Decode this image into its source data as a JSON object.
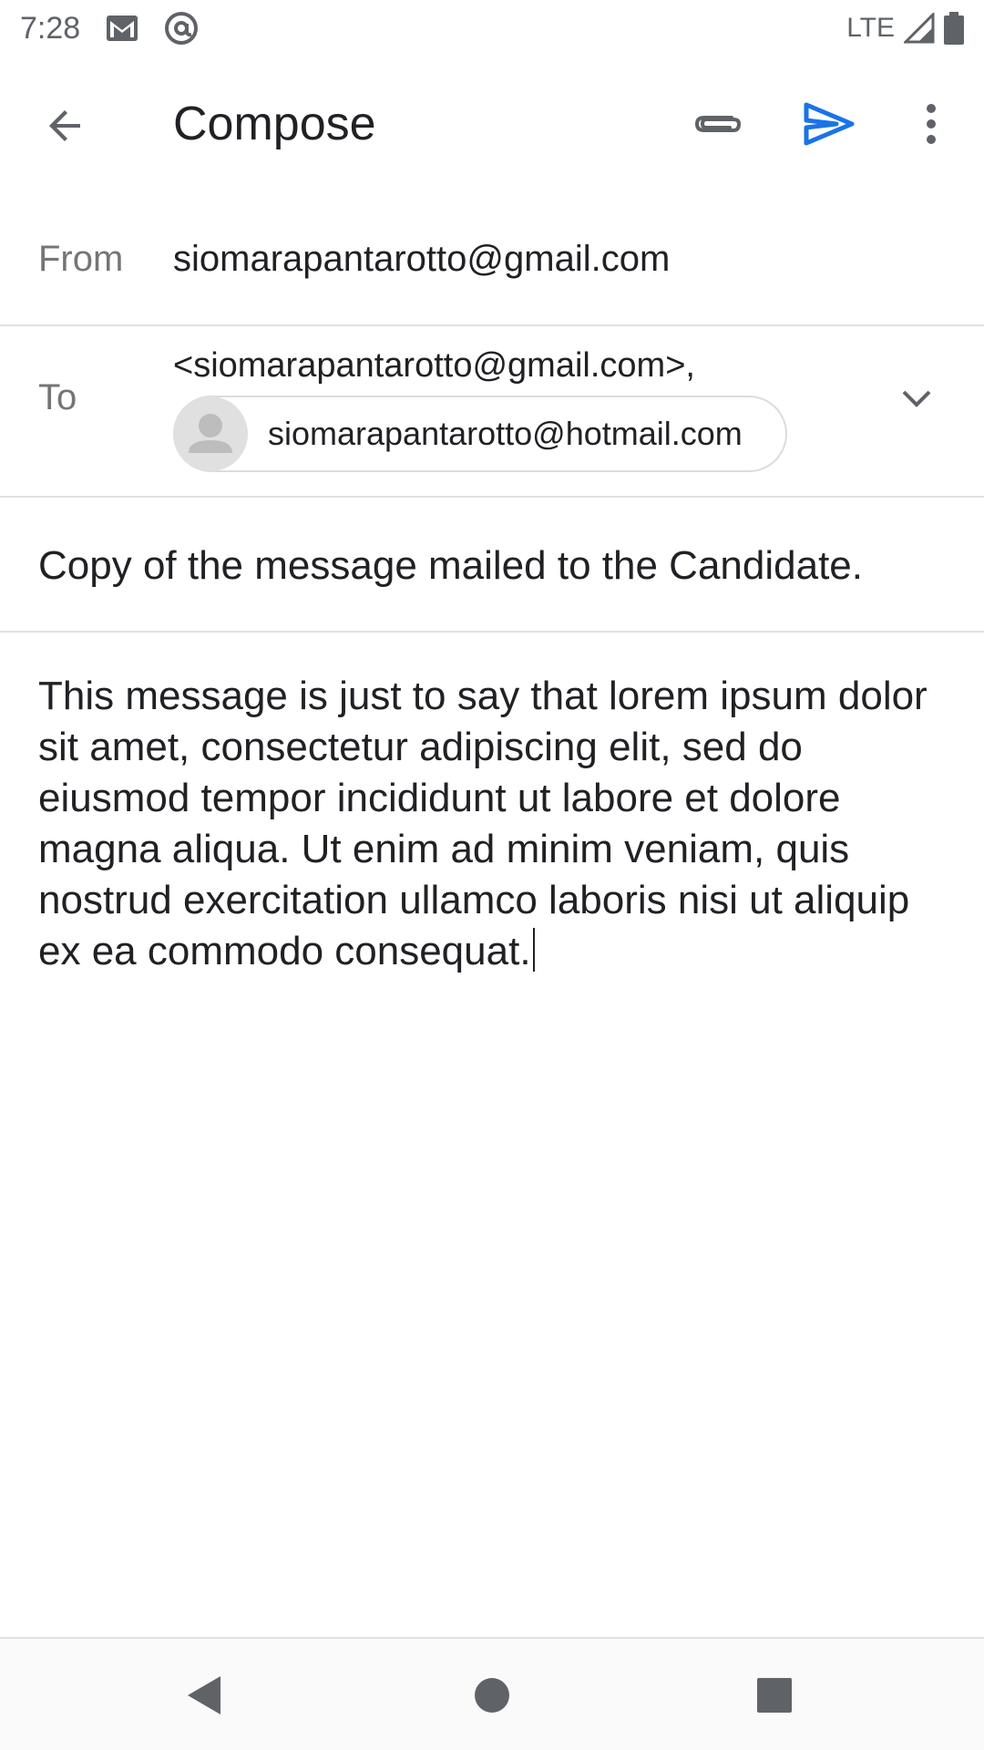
{
  "status_bar": {
    "time": "7:28",
    "network": "LTE",
    "icons": [
      "gmail-icon",
      "at-sign-icon",
      "signal-icon",
      "battery-icon"
    ]
  },
  "app_bar": {
    "title": "Compose",
    "icons": [
      "back-arrow-icon",
      "paperclip-icon",
      "send-icon",
      "more-vert-icon"
    ],
    "send_color": "#1a73e8"
  },
  "from": {
    "label": "From",
    "value": "siomarapantarotto@gmail.com"
  },
  "to": {
    "label": "To",
    "text": "<siomarapantarotto@gmail.com>,",
    "chip": "siomarapantarotto@hotmail.com"
  },
  "subject": {
    "value": "Copy of the message mailed to the Candidate."
  },
  "body": {
    "text": "This message is just to say that lorem ipsum dolor sit amet, consectetur adipiscing elit, sed do eiusmod tempor incididunt ut labore et dolore magna aliqua. Ut enim ad minim veniam, quis nostrud exercitation ullamco laboris nisi ut aliquip ex ea commodo consequat."
  },
  "nav_bar": {
    "icons": [
      "nav-back-icon",
      "nav-home-icon",
      "nav-recents-icon"
    ]
  }
}
